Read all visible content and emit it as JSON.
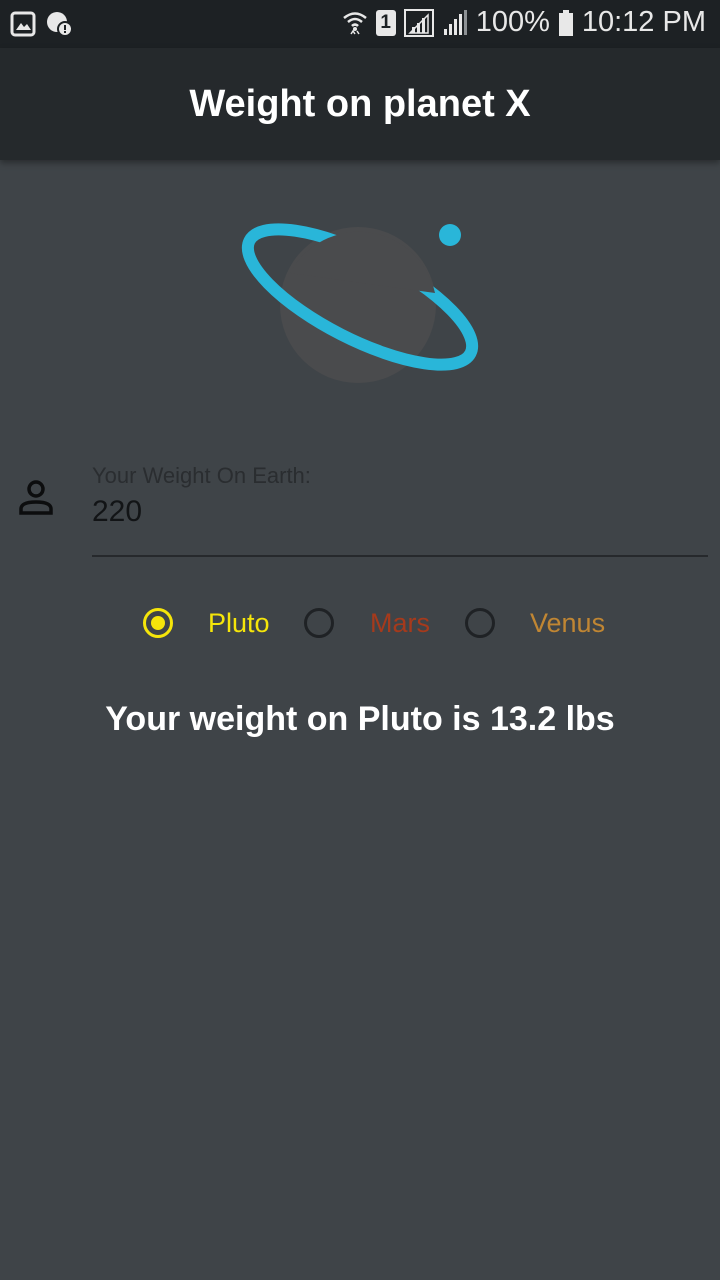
{
  "status_bar": {
    "battery": "100%",
    "time": "10:12 PM",
    "sim_slot": "1"
  },
  "app_bar": {
    "title": "Weight on planet X"
  },
  "weight_input": {
    "label": "Your Weight On Earth:",
    "value": "220"
  },
  "planets": [
    {
      "label": "Pluto",
      "selected": true,
      "color": "#f5e50a"
    },
    {
      "label": "Mars",
      "selected": false,
      "color": "#a53a1c"
    },
    {
      "label": "Venus",
      "selected": false,
      "color": "#c08633"
    }
  ],
  "result": {
    "text": "Your weight on Pluto is 13.2 lbs"
  },
  "colors": {
    "background": "#3f4448",
    "app_bar": "#25292c",
    "status_bar": "#1d2124",
    "ring": "#29b6d9",
    "planet_body": "#4a4b4d"
  }
}
